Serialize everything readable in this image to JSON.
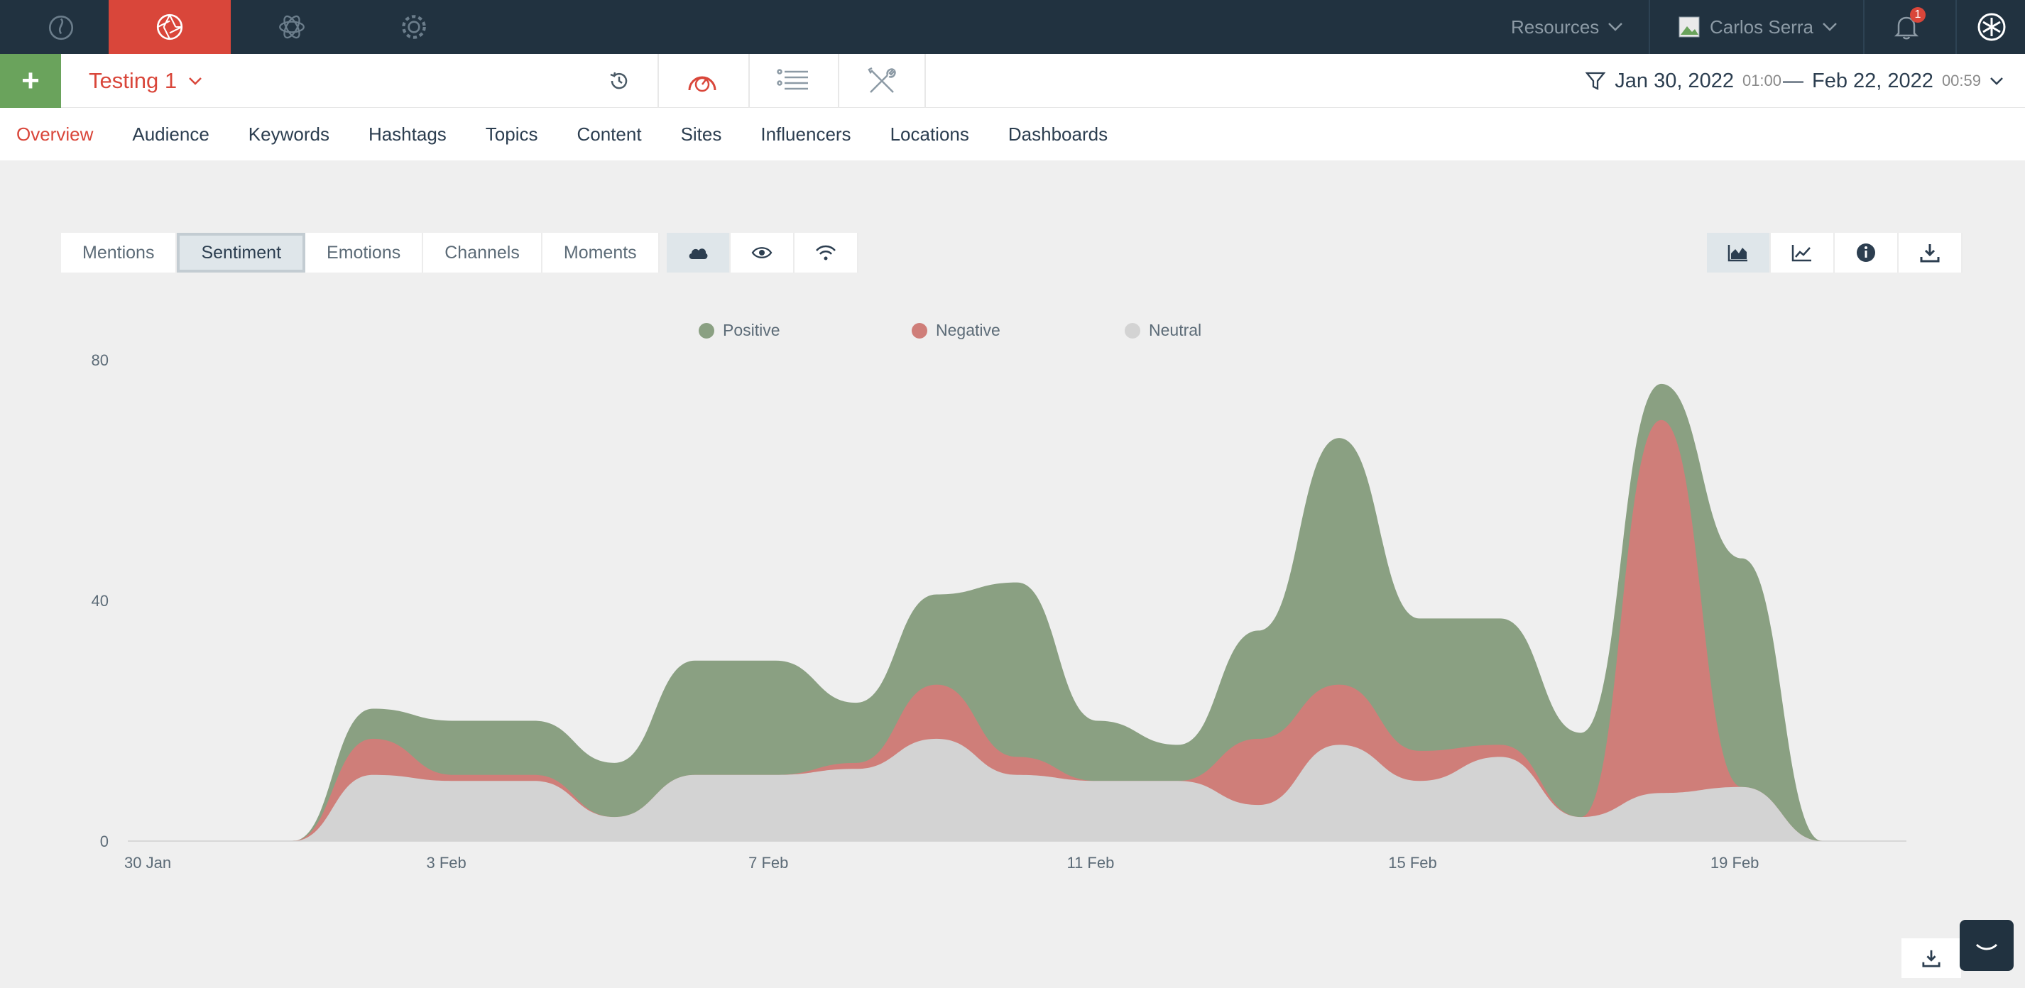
{
  "colors": {
    "accent": "#d9463a",
    "positive": "#8aa082",
    "negative": "#cf7e79",
    "neutral": "#d3d3d3",
    "topbar": "#213240",
    "add": "#6aa35c"
  },
  "topnav": {
    "items": [
      {
        "icon": "flame-icon"
      },
      {
        "icon": "aperture-icon"
      },
      {
        "icon": "atom-icon"
      },
      {
        "icon": "gear-icon"
      }
    ],
    "resources_label": "Resources",
    "user_name": "Carlos Serra",
    "notification_count": "1"
  },
  "subbar": {
    "add_label": "+",
    "project_name": "Testing 1",
    "date_start": "Jan 30, 2022",
    "time_start": "01:00",
    "dash": "—",
    "date_end": "Feb 22, 2022",
    "time_end": "00:59"
  },
  "tabs": [
    "Overview",
    "Audience",
    "Keywords",
    "Hashtags",
    "Topics",
    "Content",
    "Sites",
    "Influencers",
    "Locations",
    "Dashboards"
  ],
  "chart_tabs": [
    "Mentions",
    "Sentiment",
    "Emotions",
    "Channels",
    "Moments"
  ],
  "chart_data": {
    "type": "area",
    "stacked": true,
    "x": [
      "30 Jan",
      "31 Jan",
      "1 Feb",
      "2 Feb",
      "3 Feb",
      "4 Feb",
      "5 Feb",
      "6 Feb",
      "7 Feb",
      "8 Feb",
      "9 Feb",
      "10 Feb",
      "11 Feb",
      "12 Feb",
      "13 Feb",
      "14 Feb",
      "15 Feb",
      "16 Feb",
      "17 Feb",
      "18 Feb",
      "19 Feb",
      "20 Feb",
      "21 Feb"
    ],
    "x_ticks": [
      "30 Jan",
      "3 Feb",
      "7 Feb",
      "11 Feb",
      "15 Feb",
      "19 Feb"
    ],
    "y_ticks": [
      0,
      40,
      80
    ],
    "ylim": [
      0,
      80
    ],
    "legend_position": "top-center",
    "grid": false,
    "series": [
      {
        "name": "Neutral",
        "values": [
          0,
          0,
          0,
          11,
          10,
          10,
          4,
          11,
          11,
          12,
          17,
          11,
          10,
          10,
          6,
          16,
          10,
          14,
          4,
          8,
          9,
          0,
          0
        ]
      },
      {
        "name": "Negative",
        "values": [
          0,
          0,
          0,
          6,
          1,
          1,
          0,
          0,
          0,
          1,
          9,
          3,
          0,
          0,
          11,
          10,
          5,
          2,
          0,
          62,
          0,
          0,
          0
        ]
      },
      {
        "name": "Positive",
        "values": [
          0,
          0,
          0,
          5,
          9,
          9,
          9,
          19,
          19,
          10,
          15,
          29,
          10,
          6,
          18,
          41,
          22,
          21,
          14,
          6,
          38,
          0,
          0
        ]
      }
    ]
  }
}
